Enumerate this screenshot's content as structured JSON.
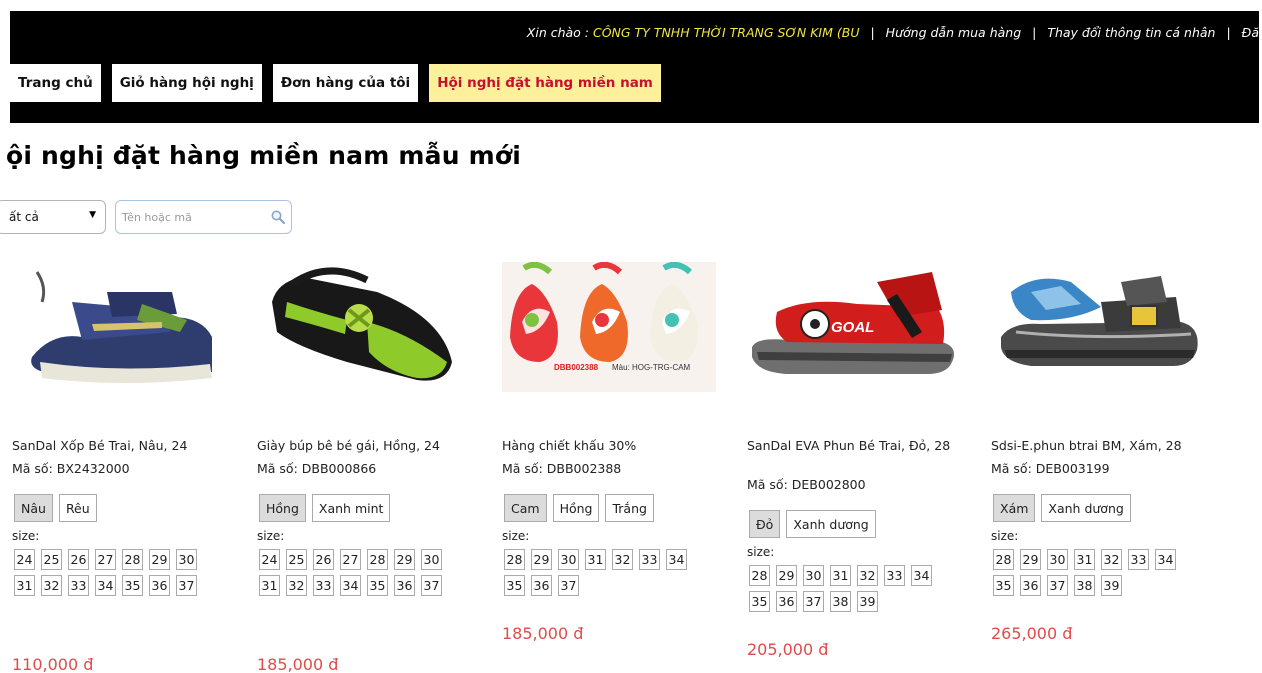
{
  "header": {
    "greeting_prefix": "Xin chào : ",
    "company": "CÔNG TY TNHH THỜI TRANG SƠN KIM (BU",
    "sep": "|",
    "links": [
      "Hướng dẫn mua hàng",
      "Thay đổi thông tin cá nhân",
      "Đă"
    ]
  },
  "nav": {
    "tabs": [
      {
        "label": "Trang chủ",
        "active": false
      },
      {
        "label": "Giỏ hàng hội nghị",
        "active": false
      },
      {
        "label": "Đơn hàng của tôi",
        "active": false
      },
      {
        "label": "Hội nghị đặt hàng miền nam",
        "active": true
      }
    ]
  },
  "page_title": "ội nghị đặt hàng miền nam mẫu mới",
  "filter": {
    "category_value": "ất cả",
    "search_placeholder": "Tên hoặc mã"
  },
  "products": [
    {
      "name": "SanDal Xốp Bé Trai, Nâu, 24",
      "code": "Mã số: BX2432000",
      "colors": [
        "Nâu",
        "Rêu"
      ],
      "size_label": "size:",
      "sizes": [
        "24",
        "25",
        "26",
        "27",
        "28",
        "29",
        "30",
        "31",
        "32",
        "33",
        "34",
        "35",
        "36",
        "37"
      ],
      "price": "110,000 đ"
    },
    {
      "name": "Giày búp bê bé gái, Hồng, 24",
      "code": "Mã số: DBB000866",
      "colors": [
        "Hồng",
        "Xanh mint"
      ],
      "size_label": "size:",
      "sizes": [
        "24",
        "25",
        "26",
        "27",
        "28",
        "29",
        "30",
        "31",
        "32",
        "33",
        "34",
        "35",
        "36",
        "37"
      ],
      "price": "185,000 đ"
    },
    {
      "name": "Hàng chiết khấu 30%",
      "code": "Mã số: DBB002388",
      "colors": [
        "Cam",
        "Hồng",
        "Trắng"
      ],
      "size_label": "size:",
      "sizes": [
        "28",
        "29",
        "30",
        "31",
        "32",
        "33",
        "34",
        "35",
        "36",
        "37"
      ],
      "price": "185,000 đ",
      "image_caption": "DBB002388 Màu: HOG-TRG-CAM"
    },
    {
      "name": "SanDal EVA Phun Bé Trai, Đỏ, 28",
      "code": "Mã số: DEB002800",
      "colors": [
        "Đỏ",
        "Xanh dương"
      ],
      "size_label": "size:",
      "sizes": [
        "28",
        "29",
        "30",
        "31",
        "32",
        "33",
        "34",
        "35",
        "36",
        "37",
        "38",
        "39"
      ],
      "price": "205,000 đ",
      "image_text": "GOAL"
    },
    {
      "name": "Sdsi-E.phun btrai BM, Xám, 28",
      "code": "Mã số: DEB003199",
      "colors": [
        "Xám",
        "Xanh dương"
      ],
      "size_label": "size:",
      "sizes": [
        "28",
        "29",
        "30",
        "31",
        "32",
        "33",
        "34",
        "35",
        "36",
        "37",
        "38",
        "39"
      ],
      "price": "265,000 đ"
    }
  ]
}
